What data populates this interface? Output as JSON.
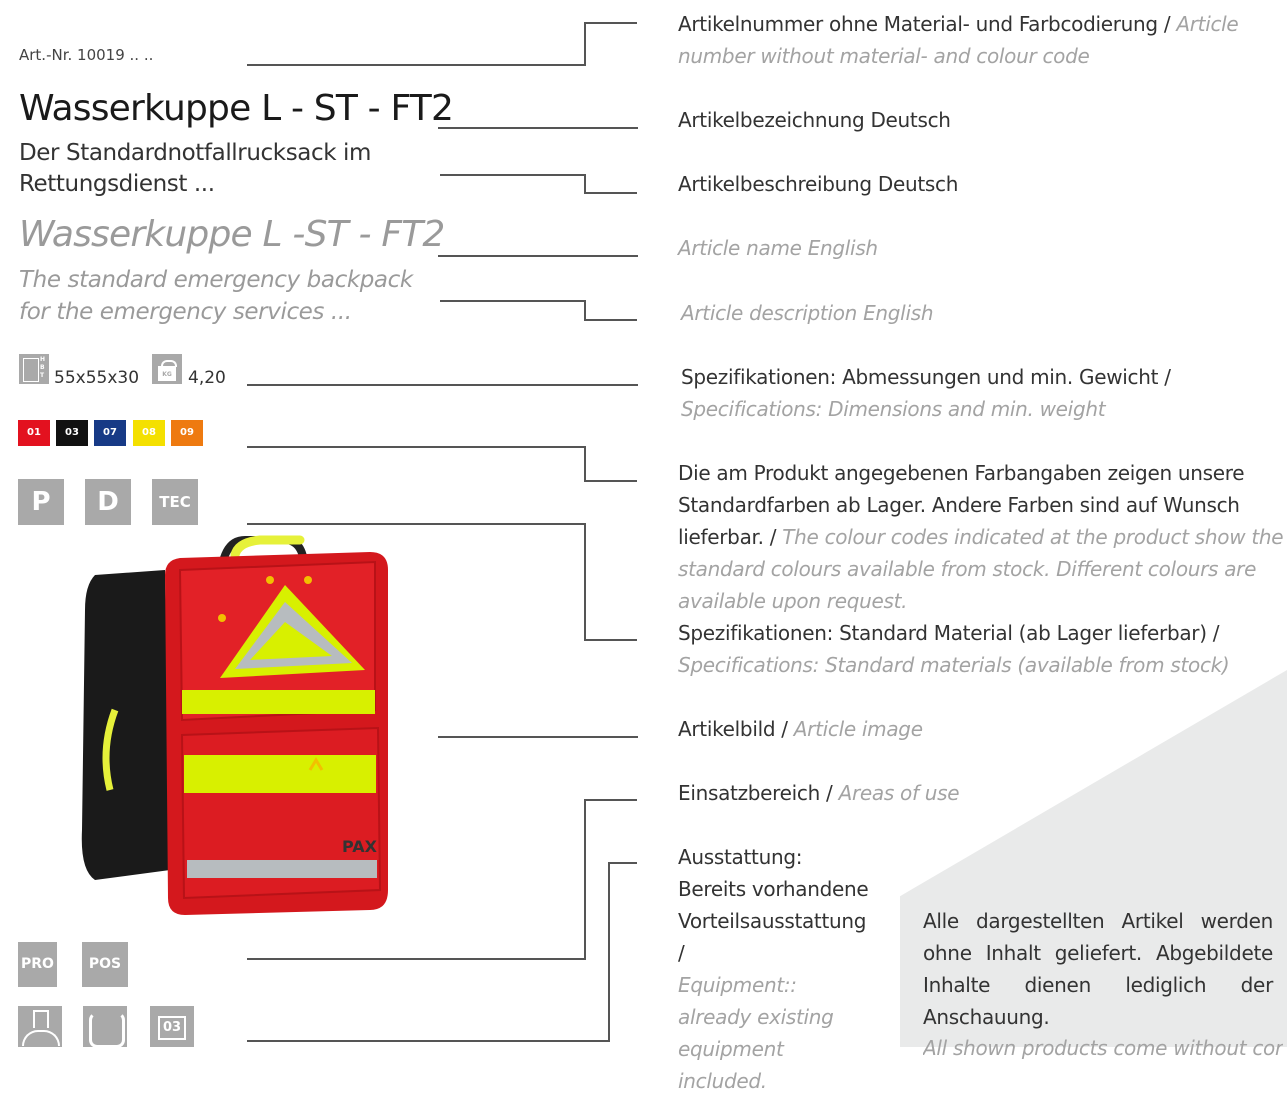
{
  "left": {
    "art_nr": "Art.-Nr. 10019 .. ..",
    "title_de": "Wasserkuppe L - ST - FT2",
    "desc_de_1": "Der Standardnotfallrucksack im",
    "desc_de_2": "Rettungsdienst  ...",
    "title_en": "Wasserkuppe L -ST - FT2",
    "desc_en_1": "The standard emergency backpack",
    "desc_en_2": "for the emergency services  ...",
    "dimensions": "55x55x30",
    "dimension_icon_letters": "H B T",
    "weight": "4,20",
    "weight_icon_label": "KG",
    "colors": [
      {
        "code": "01",
        "hex": "#e3111f"
      },
      {
        "code": "03",
        "hex": "#111111"
      },
      {
        "code": "07",
        "hex": "#173a86"
      },
      {
        "code": "08",
        "hex": "#f4e000"
      },
      {
        "code": "09",
        "hex": "#ee7a10"
      }
    ],
    "materials": [
      "P",
      "D",
      "TEC"
    ],
    "areas": [
      "PRO",
      "POS"
    ],
    "equipment_badge": "03",
    "product_brand": "PAX"
  },
  "right": {
    "r1_de": "Artikelnummer ohne Material- und Farbcodierung / ",
    "r1_en": "Article number without material- and colour code",
    "r2": "Artikelbezeichnung Deutsch",
    "r3": "Artikelbeschreibung Deutsch",
    "r4": "Article name English",
    "r5": "Article description English",
    "r6_de": "Spezifikationen: Abmessungen und min. Gewicht / ",
    "r6_en": "Specifications: Dimensions and min. weight",
    "r7_de": "Die am Produkt angegebenen Farbangaben zeigen unsere Standardfarben ab Lager. Andere Farben sind auf Wunsch lieferbar. / ",
    "r7_en": "The colour codes indicated at the product show the standard colours available from stock. Different colours are available upon request.",
    "r8_de": "Spezifikationen: Standard Material (ab Lager lieferbar) / ",
    "r8_en": "Specifications: Standard materials (available from stock)",
    "r9_de": "Artikelbild / ",
    "r9_en": "Article image",
    "r10_de": "Einsatzbereich / ",
    "r10_en": "Areas of use",
    "r11_de_1": "Ausstattung:",
    "r11_de_2": "Bereits vorhandene",
    "r11_de_3": "Vorteilsausstattung /",
    "r11_en_1": "Equipment::",
    "r11_en_2": "already existing",
    "r11_en_3": "equipment included."
  },
  "note": {
    "de": "Alle dargestellten Artikel werden ohne Inhalt geliefert. Abgebildete Inhalte dienen lediglich der Anschauung.",
    "en": "All shown products come without con"
  }
}
